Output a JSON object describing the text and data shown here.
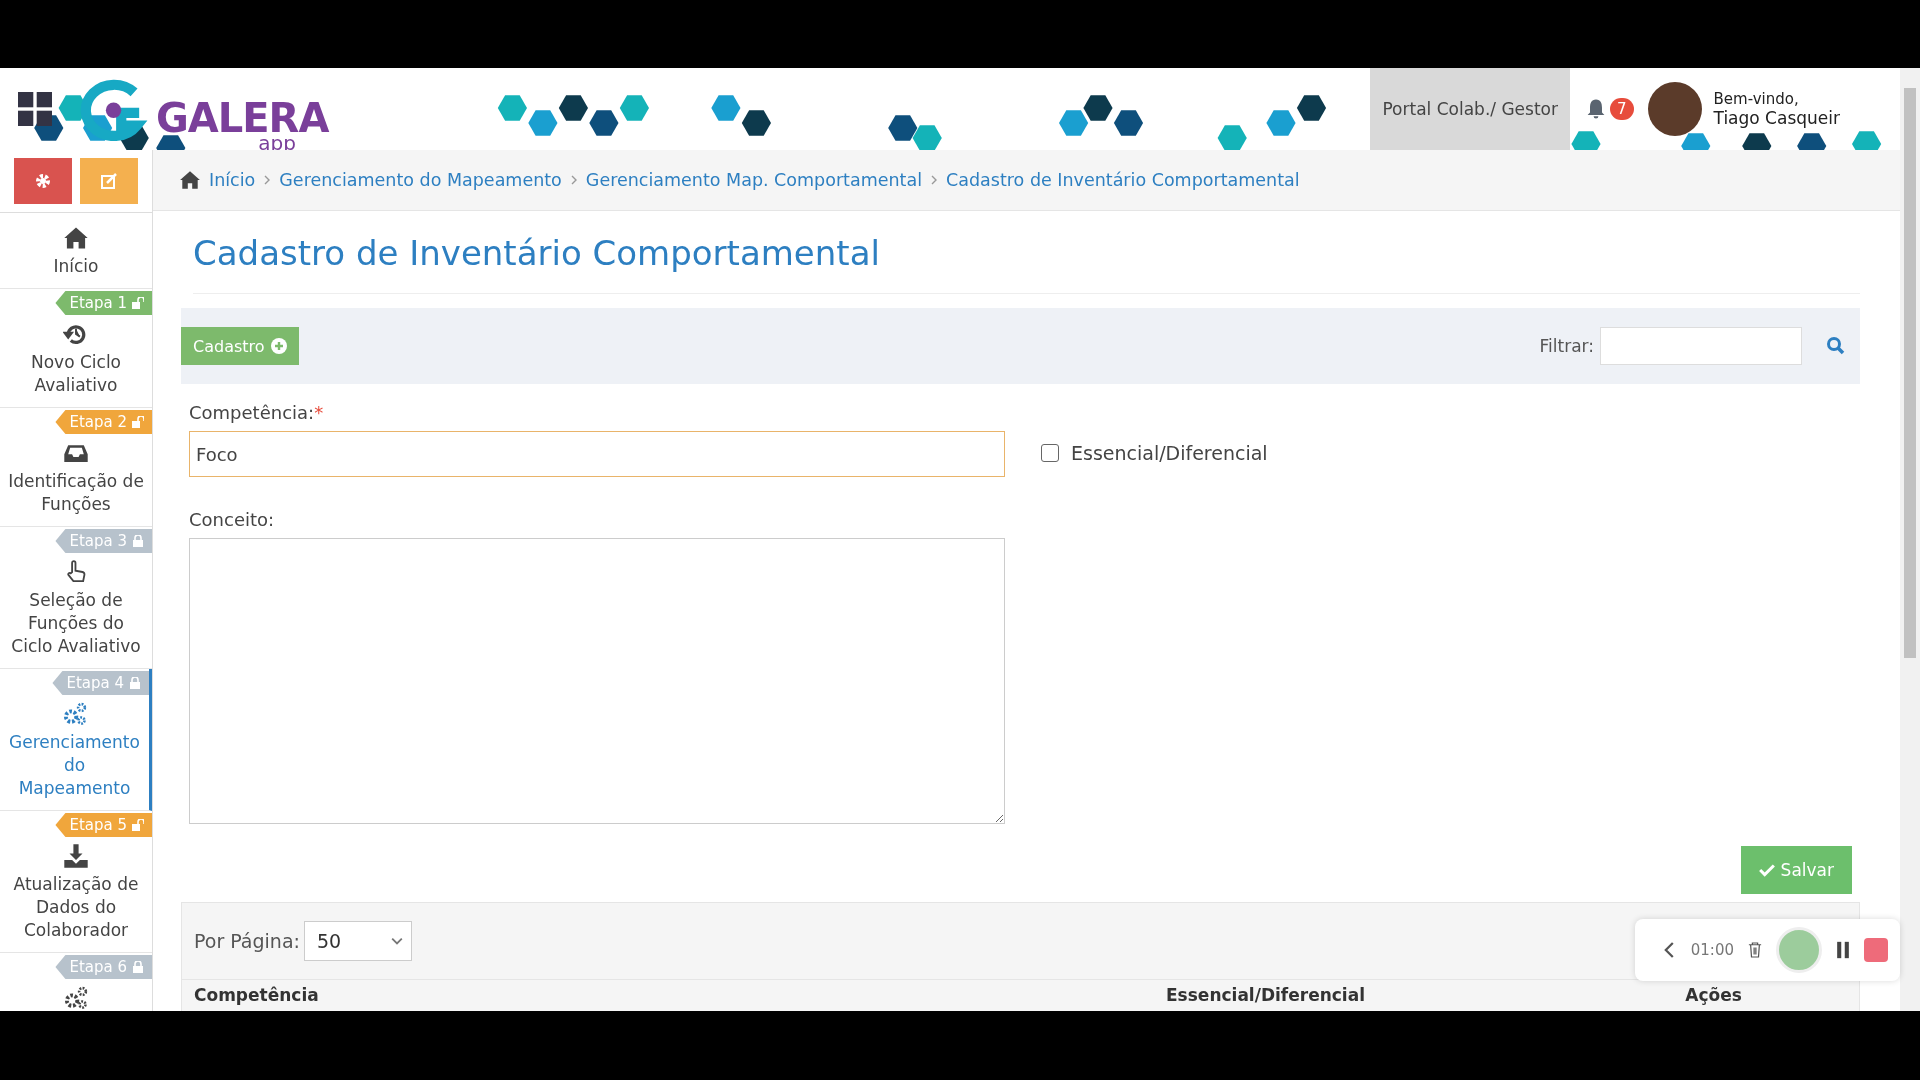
{
  "header": {
    "logo": {
      "name": "GALERA",
      "suffix": "app"
    },
    "portal": "Portal Colab./ Gestor",
    "notifications": "7",
    "welcome": "Bem-vindo,",
    "user": "Tiago Casqueir"
  },
  "sidebar": {
    "items": [
      {
        "label": "Início",
        "selected": false
      },
      {
        "stage": {
          "label": "Etapa 1",
          "locked": false,
          "color": "#7dba6c"
        },
        "label": "Novo Ciclo Avaliativo",
        "selected": false
      },
      {
        "stage": {
          "label": "Etapa 2",
          "locked": false,
          "color": "#f0a63c"
        },
        "label": "Identificação de Funções",
        "selected": false
      },
      {
        "stage": {
          "label": "Etapa 3",
          "locked": true,
          "color": "#b7c2cc"
        },
        "label": "Seleção de Funções do Ciclo Avaliativo",
        "selected": false
      },
      {
        "stage": {
          "label": "Etapa 4",
          "locked": true,
          "color": "#b7c2cc"
        },
        "label": "Gerenciamento do Mapeamento",
        "selected": true
      },
      {
        "stage": {
          "label": "Etapa 5",
          "locked": false,
          "color": "#f0a63c"
        },
        "label": "Atualização de Dados do Colaborador",
        "selected": false
      },
      {
        "stage": {
          "label": "Etapa 6",
          "locked": true,
          "color": "#b7c2cc"
        },
        "selected": false
      }
    ]
  },
  "breadcrumb": [
    "Início",
    "Gerenciamento do Mapeamento",
    "Gerenciamento Map. Comportamental",
    "Cadastro de Inventário Comportamental"
  ],
  "page_title": "Cadastro de Inventário Comportamental",
  "toolbar": {
    "add_button": "Cadastro",
    "filter_label": "Filtrar:"
  },
  "form": {
    "competencia": {
      "label": "Competência:",
      "required": "*",
      "value": "Foco"
    },
    "essencial": {
      "label": "Essencial/Diferencial",
      "checked": false
    },
    "conceito": {
      "label": "Conceito:"
    },
    "save": "Salvar"
  },
  "table": {
    "per_page_label": "Por Página:",
    "per_page": "50",
    "columns": [
      "Competência",
      "Essencial/Diferencial",
      "Ações"
    ]
  },
  "recorder": {
    "time": "01:00"
  }
}
